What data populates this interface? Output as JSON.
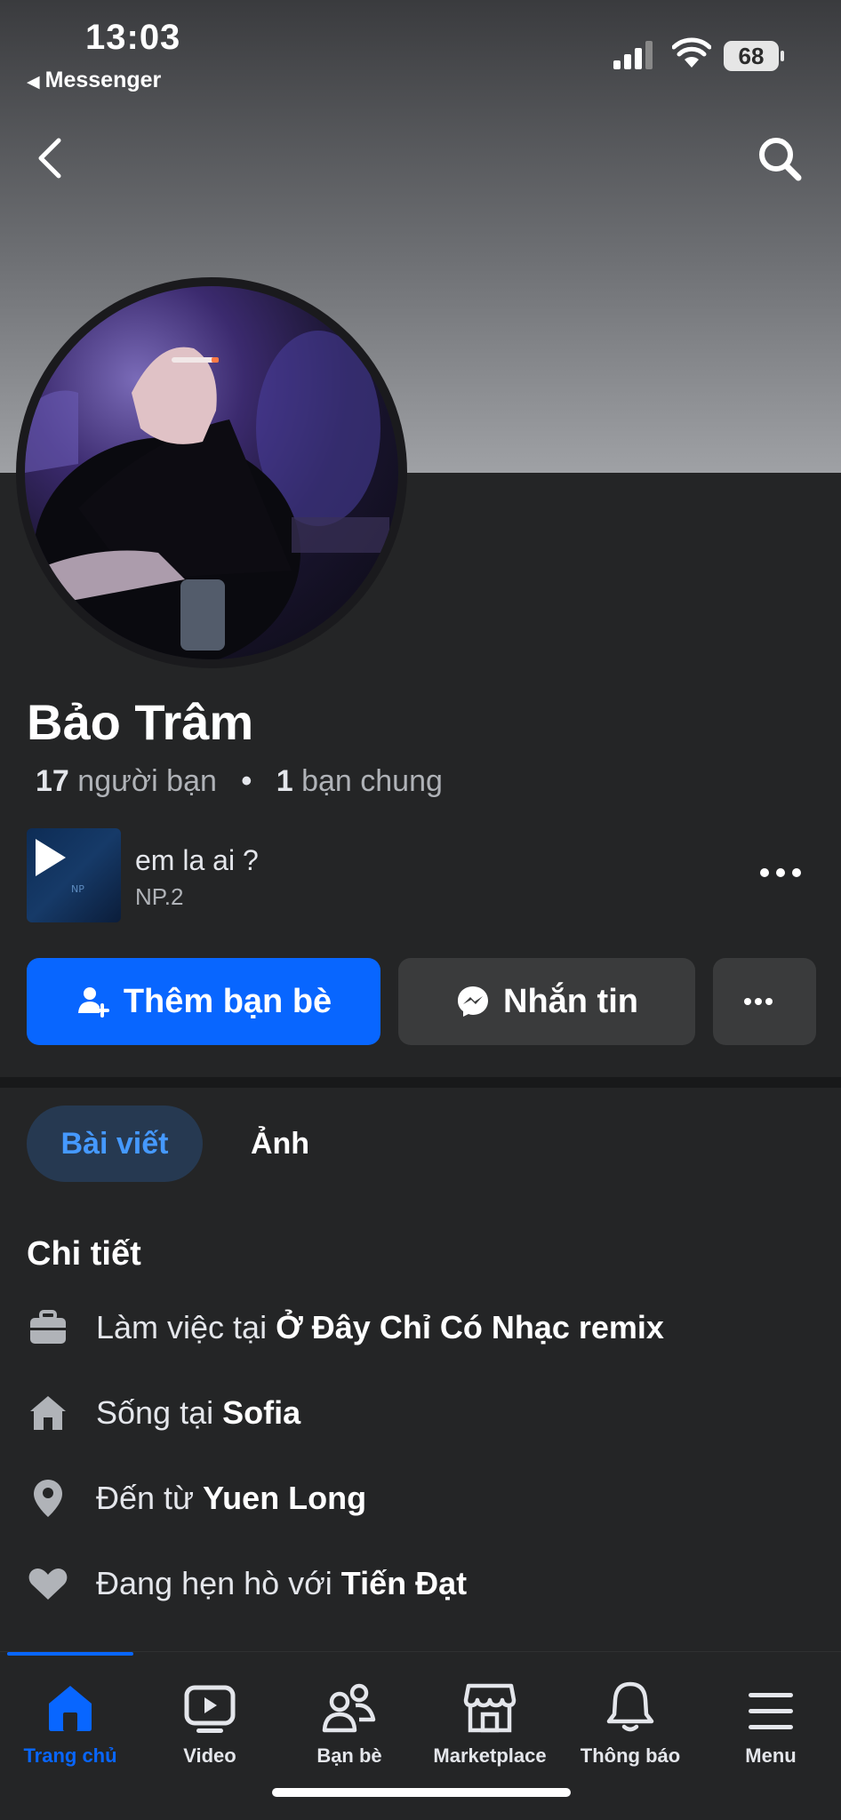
{
  "status_bar": {
    "time": "13:03",
    "back_app": "Messenger",
    "battery": "68"
  },
  "profile": {
    "name": "Bảo Trâm",
    "friends_count": "17",
    "friends_label": "người bạn",
    "mutual_count": "1",
    "mutual_label": "bạn chung",
    "separator": "•"
  },
  "music": {
    "title": "em la ai ?",
    "artist": "NP.2"
  },
  "actions": {
    "add_friend": "Thêm bạn bè",
    "message": "Nhắn tin"
  },
  "tabs": {
    "posts": "Bài viết",
    "photos": "Ảnh"
  },
  "details": {
    "title": "Chi tiết",
    "items": [
      {
        "icon": "briefcase-icon",
        "prefix": "Làm việc tại",
        "value": "Ở Đây Chỉ Có Nhạc remix"
      },
      {
        "icon": "home-icon",
        "prefix": "Sống tại",
        "value": "Sofia"
      },
      {
        "icon": "location-pin-icon",
        "prefix": "Đến từ",
        "value": "Yuen Long"
      },
      {
        "icon": "heart-icon",
        "prefix": "Đang hẹn hò với",
        "value": "Tiến Đạt"
      }
    ]
  },
  "bottom_nav": {
    "items": [
      {
        "label": "Trang chủ",
        "icon": "home-icon",
        "active": true
      },
      {
        "label": "Video",
        "icon": "video-icon",
        "active": false
      },
      {
        "label": "Bạn bè",
        "icon": "friends-icon",
        "active": false
      },
      {
        "label": "Marketplace",
        "icon": "marketplace-icon",
        "active": false
      },
      {
        "label": "Thông báo",
        "icon": "bell-icon",
        "active": false
      },
      {
        "label": "Menu",
        "icon": "menu-icon",
        "active": false
      }
    ]
  },
  "colors": {
    "accent": "#0866ff",
    "background": "#242526",
    "button_secondary": "#3a3b3c"
  }
}
